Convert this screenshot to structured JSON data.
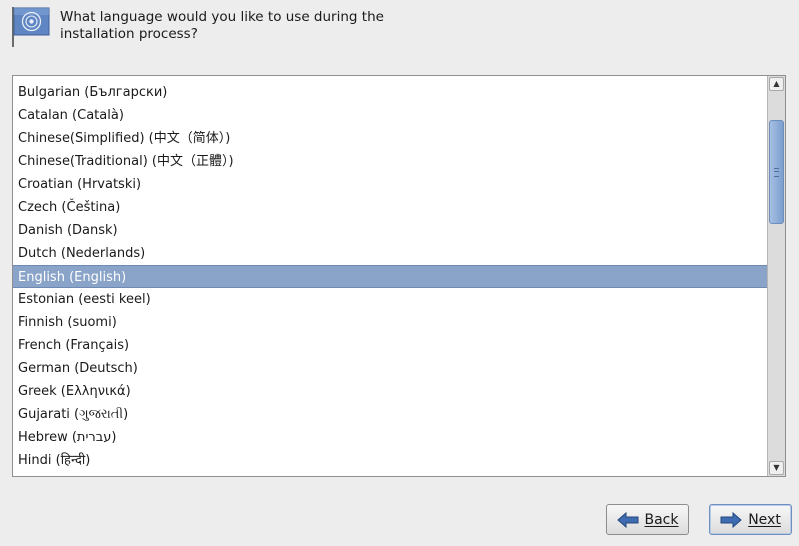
{
  "header": {
    "prompt": "What language would you like to use during the\ninstallation process?",
    "icon": "flag-icon"
  },
  "languages": [
    "Bulgarian (Български)",
    "Catalan (Català)",
    "Chinese(Simplified) (中文（简体）)",
    "Chinese(Traditional) (中文（正體）)",
    "Croatian (Hrvatski)",
    "Czech (Čeština)",
    "Danish (Dansk)",
    "Dutch (Nederlands)",
    "English (English)",
    "Estonian (eesti keel)",
    "Finnish (suomi)",
    "French (Français)",
    "German (Deutsch)",
    "Greek (Ελληνικά)",
    "Gujarati (ગુજરાતી)",
    "Hebrew (עברית)",
    "Hindi (हिन्दी)"
  ],
  "selected_language": "English (English)",
  "buttons": {
    "back_label": "Back",
    "next_label": "Next"
  },
  "colors": {
    "selection": "#8aa3c8",
    "background": "#ededed"
  }
}
